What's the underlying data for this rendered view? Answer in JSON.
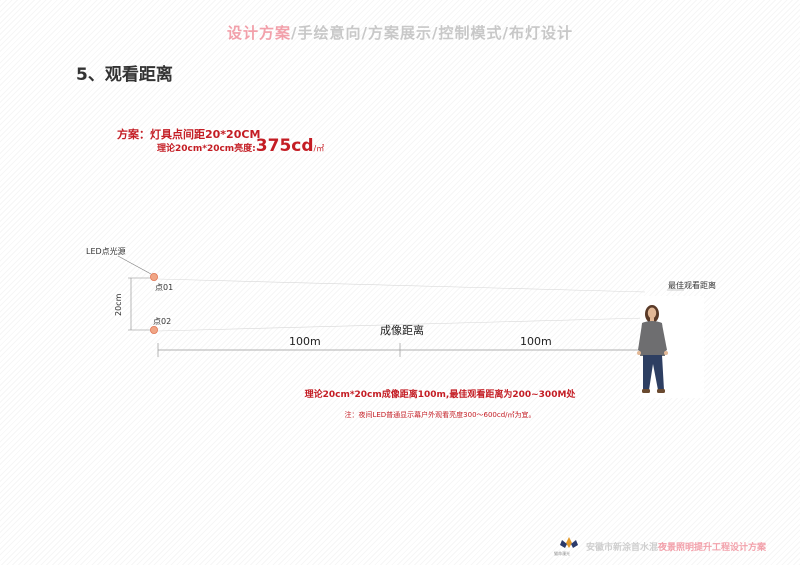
{
  "nav": {
    "items": [
      "设计方案",
      "手绘意向",
      "方案展示",
      "控制模式",
      "布灯设计"
    ],
    "separator": "/",
    "active_index": 0
  },
  "section_title": "5、观看距离",
  "plan": {
    "line1": "方案：灯具点间距20*20CM",
    "line2_prefix": "理论20cm*20cm亮度:",
    "line2_value": "375cd",
    "line2_unit": "/㎡"
  },
  "diagram": {
    "led_label": "LED点光源",
    "point1": "点01",
    "point2": "点02",
    "vertical_label": "20cm",
    "center_label": "成像距离",
    "left_distance": "100m",
    "right_distance": "100m",
    "viewer_label": "最佳观看距离"
  },
  "caption": "理论20cm*20cm成像距离100m,最佳观看距离为200~300M处",
  "note": "注：夜间LED普通显示幕户外观看亮度300～600cd/㎡为宜。",
  "footer": {
    "grey_text": "安徽市新涂首水混",
    "pink_text": "夜景照明提升工程设计方案",
    "logo_label": "猫命漫光"
  },
  "colors": {
    "accent_red": "#c41d24",
    "nav_active": "#f2a0aa",
    "led_dot": "#f0a585"
  }
}
